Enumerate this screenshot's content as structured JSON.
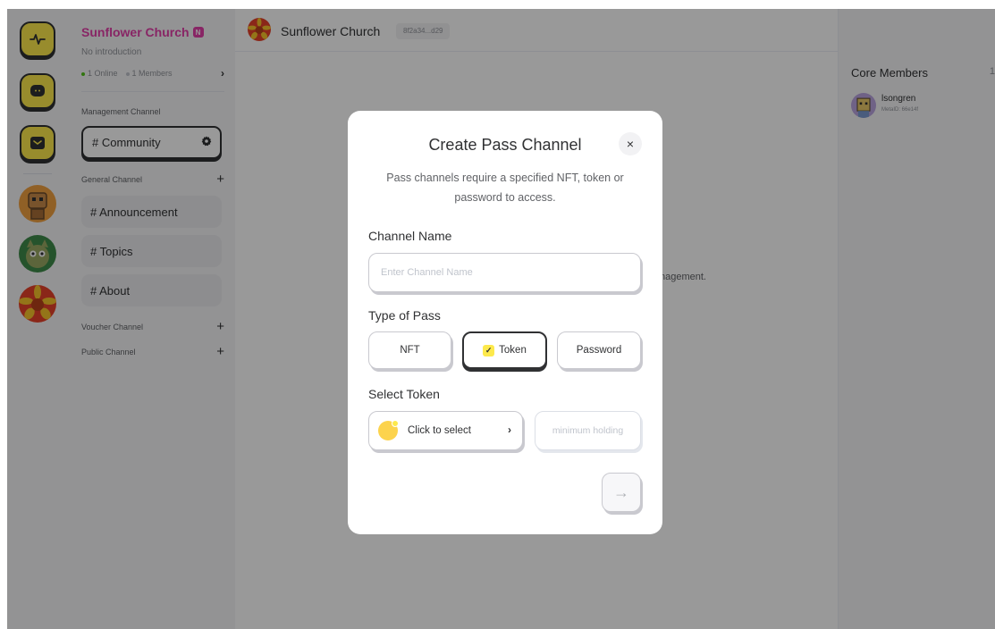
{
  "community": {
    "name": "Sunflower Church",
    "badge": "N",
    "intro": "No introduction",
    "online": "1 Online",
    "members": "1 Members"
  },
  "sidebar": {
    "management_section": "Management Channel",
    "community_channel": "# Community",
    "general_section": "General Channel",
    "general_channels": [
      "# Announcement",
      "# Topics",
      "# About"
    ],
    "voucher_section": "Voucher Channel",
    "public_section": "Public Channel"
  },
  "header": {
    "title": "Sunflower Church",
    "hash": "8f2a34...d29"
  },
  "background_text": "nagement.",
  "right_panel": {
    "title": "Core Members",
    "count": "1",
    "member_name": "lsongren",
    "member_id": "MetaID: 66e14f"
  },
  "modal": {
    "title": "Create Pass Channel",
    "close": "×",
    "description": "Pass channels require a specified NFT, token or password to access.",
    "channel_name_label": "Channel Name",
    "channel_name_placeholder": "Enter Channel Name",
    "type_label": "Type of Pass",
    "options": {
      "nft": "NFT",
      "token": "Token",
      "password": "Password"
    },
    "selected_option": "Token",
    "select_token_label": "Select Token",
    "token_select_text": "Click to select",
    "min_holding_placeholder": "minimum holding",
    "next_arrow": "→"
  },
  "colors": {
    "accent_yellow": "#fde94c",
    "brand_pink": "#e33fa8",
    "online_dot": "#52c41a"
  },
  "icons": {
    "rail": [
      "activity-icon",
      "chat-icon",
      "inbox-icon"
    ],
    "header": [
      "wallet-icon",
      "more-icon"
    ],
    "channel": "gear-icon"
  }
}
